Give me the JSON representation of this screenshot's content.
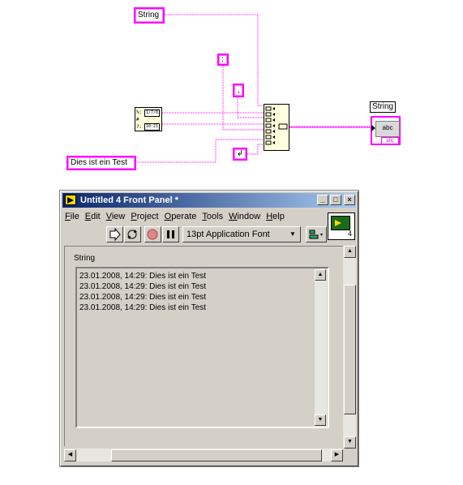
{
  "diagram": {
    "const_string": "String",
    "const_colon": ":",
    "const_comma": ",",
    "const_text": "Dies ist ein Test",
    "indicator_label": "String",
    "indicator_text": "abc",
    "timestamp_rows": [
      "%:",
      "#",
      "?:"
    ],
    "timestamp_boxes": [
      "1/7/8",
      "10:21"
    ]
  },
  "window": {
    "title": "Untitled 4 Front Panel *",
    "menu": [
      "File",
      "Edit",
      "View",
      "Project",
      "Operate",
      "Tools",
      "Window",
      "Help"
    ],
    "font": "13pt Application Font",
    "vi_number": "4",
    "control_label": "String",
    "lines": [
      "23.01.2008, 14:29: Dies ist ein Test",
      "23.01.2008, 14:29: Dies ist ein Test",
      "23.01.2008, 14:29: Dies ist ein Test",
      "23.01.2008, 14:29: Dies ist ein Test"
    ]
  },
  "colors": {
    "wire": "#ff00ff",
    "titlebar_start": "#0a246a",
    "titlebar_end": "#a6caf0",
    "chrome": "#d4d0c8"
  }
}
